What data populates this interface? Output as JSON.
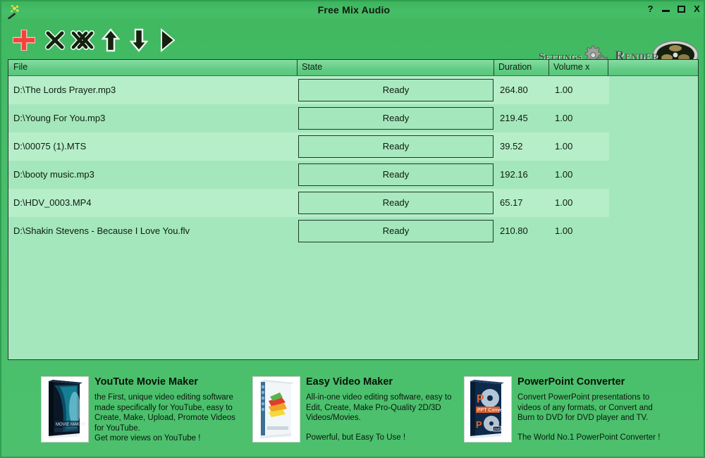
{
  "window": {
    "title": "Free Mix Audio",
    "app_icon": "magic-wand-icon",
    "controls": {
      "help": "?",
      "minimize": "minimize-icon",
      "maximize": "maximize-icon",
      "close": "X"
    }
  },
  "toolbar": {
    "add": "add-file-icon",
    "remove": "remove-file-icon",
    "remove_all": "remove-all-files-icon",
    "move_up": "move-up-icon",
    "move_down": "move-down-icon",
    "play": "play-icon",
    "settings_label": "Settings",
    "render_label": "Render"
  },
  "list": {
    "columns": [
      "File",
      "State",
      "Duration",
      "Volume x",
      ""
    ],
    "rows": [
      {
        "file": "D:\\The Lords Prayer.mp3",
        "state": "Ready",
        "duration": "264.80",
        "volume": "1.00"
      },
      {
        "file": "D:\\Young For You.mp3",
        "state": "Ready",
        "duration": "219.45",
        "volume": "1.00"
      },
      {
        "file": "D:\\00075 (1).MTS",
        "state": "Ready",
        "duration": "39.52",
        "volume": "1.00"
      },
      {
        "file": "D:\\booty music.mp3",
        "state": "Ready",
        "duration": "192.16",
        "volume": "1.00"
      },
      {
        "file": "D:\\HDV_0003.MP4",
        "state": "Ready",
        "duration": "65.17",
        "volume": "1.00"
      },
      {
        "file": "D:\\Shakin Stevens - Because I Love You.flv",
        "state": "Ready",
        "duration": "210.80",
        "volume": "1.00"
      }
    ]
  },
  "promos": [
    {
      "title": "YouTute Movie Maker",
      "description": "the First, unique video editing software\nmade specifically for YouTube, easy to\nCreate, Make, Upload, Promote Videos\nfor YouTube.",
      "tagline": "Get more views on YouTube !"
    },
    {
      "title": "Easy Video Maker",
      "description": "All-in-one video editing software, easy to\nEdit, Create, Make Pro-Quality 2D/3D\nVideos/Movies.",
      "tagline": "Powerful, but Easy To Use !"
    },
    {
      "title": "PowerPoint Converter",
      "description": "Convert PowerPoint presentations to\nvideos of any formats, or Convert and\nBurn to DVD for DVD player and TV.",
      "tagline": "The World No.1 PowerPoint Converter !"
    }
  ],
  "colors": {
    "window_green": "#4cc06d",
    "titlebar_green": "#41b962",
    "list_row": "#a4e7bd",
    "list_row_alt": "#b6eeca",
    "header_green": "#62cc84",
    "add_red": "#f4433c",
    "text_dark": "#0e1c0e"
  }
}
